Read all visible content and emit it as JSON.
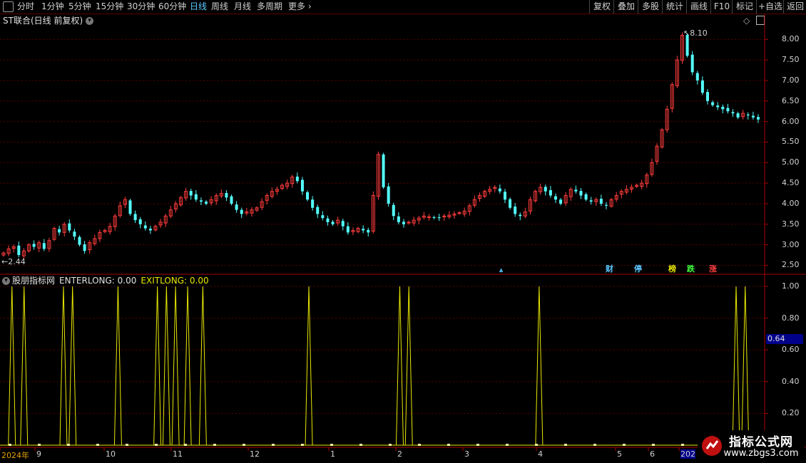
{
  "toolbar": {
    "periods": [
      "分时",
      "1分钟",
      "5分钟",
      "15分钟",
      "30分钟",
      "60分钟",
      "日线",
      "周线",
      "月线",
      "多周期",
      "更多"
    ],
    "active_period": "日线",
    "buttons": [
      "复权",
      "叠加",
      "多股",
      "统计",
      "画线",
      "F10",
      "标记",
      "+自选",
      "返回"
    ]
  },
  "main_title": "ST联合(日线 前复权)",
  "price_axis": [
    "8.00",
    "7.50",
    "7.00",
    "6.50",
    "6.00",
    "5.50",
    "5.00",
    "4.50",
    "4.00",
    "3.50",
    "3.00",
    "2.50"
  ],
  "high_label": "8.10",
  "low_label": "2.44",
  "markers": [
    {
      "text": "财",
      "color": "#5cc8ff"
    },
    {
      "text": "停",
      "color": "#5cc8ff"
    },
    {
      "text": "榜",
      "color": "#e8e800"
    },
    {
      "text": "跌",
      "color": "#40ff40"
    },
    {
      "text": "涨",
      "color": "#ff4040"
    }
  ],
  "indicator": {
    "name": "股朋指标网",
    "enterlong": "ENTERLONG: 0.00",
    "exitlong": "EXITLONG: 0.00",
    "axis": [
      "1.00",
      "0.80",
      "0.60",
      "0.40",
      "0.20"
    ],
    "current_value": "0.64"
  },
  "date_axis": [
    "2024年",
    "9",
    "10",
    "11",
    "12",
    "1",
    "2",
    "3",
    "4",
    "5",
    "6",
    "202"
  ],
  "watermark": {
    "title": "指标公式网",
    "url": "www.zbgs3.com"
  },
  "colors": {
    "up": "#ff3c3c",
    "down": "#54ffff",
    "signal": "#e8e800",
    "grid": "#5a0000",
    "axis": "#aa0000"
  },
  "chart_data": [
    {
      "type": "candlestick",
      "title": "ST联合(日线 前复权)",
      "ylim": [
        2.3,
        8.3
      ],
      "close": [
        2.8,
        2.9,
        2.95,
        2.75,
        2.85,
        3.0,
        2.95,
        3.05,
        2.9,
        3.1,
        3.4,
        3.3,
        3.5,
        3.35,
        3.2,
        3.0,
        2.85,
        3.05,
        3.15,
        3.3,
        3.35,
        3.45,
        3.7,
        3.95,
        4.1,
        3.75,
        3.6,
        3.5,
        3.4,
        3.35,
        3.45,
        3.55,
        3.7,
        3.85,
        4.0,
        4.15,
        4.3,
        4.2,
        4.1,
        4.05,
        4.0,
        4.1,
        4.2,
        4.25,
        4.15,
        4.0,
        3.85,
        3.75,
        3.8,
        3.85,
        3.9,
        4.05,
        4.2,
        4.3,
        4.35,
        4.45,
        4.5,
        4.65,
        4.55,
        4.3,
        4.1,
        3.9,
        3.75,
        3.65,
        3.55,
        3.5,
        3.6,
        3.45,
        3.3,
        3.35,
        3.4,
        3.35,
        3.3,
        4.2,
        5.2,
        4.4,
        4.0,
        3.7,
        3.55,
        3.5,
        3.55,
        3.6,
        3.65,
        3.7,
        3.68,
        3.66,
        3.65,
        3.7,
        3.72,
        3.75,
        3.78,
        3.82,
        3.95,
        4.1,
        4.2,
        4.3,
        4.35,
        4.4,
        4.3,
        4.1,
        3.9,
        3.75,
        3.7,
        3.8,
        4.1,
        4.3,
        4.4,
        4.3,
        4.2,
        4.1,
        4.0,
        4.2,
        4.35,
        4.3,
        4.2,
        4.1,
        4.05,
        4.1,
        4.0,
        3.95,
        4.1,
        4.2,
        4.3,
        4.35,
        4.4,
        4.45,
        4.5,
        4.7,
        5.0,
        5.4,
        5.8,
        6.3,
        6.9,
        7.5,
        8.1,
        7.6,
        7.2,
        7.0,
        6.7,
        6.5,
        6.4,
        6.35,
        6.3,
        6.25,
        6.2,
        6.1,
        6.2,
        6.15,
        6.1,
        6.05
      ]
    },
    {
      "type": "line",
      "title": "股朋指标网",
      "ylim": [
        0,
        1.0
      ],
      "spikes": [
        3,
        7,
        20,
        23,
        38,
        51,
        54,
        57,
        61,
        66,
        101,
        131,
        134,
        177,
        242,
        245
      ]
    }
  ]
}
